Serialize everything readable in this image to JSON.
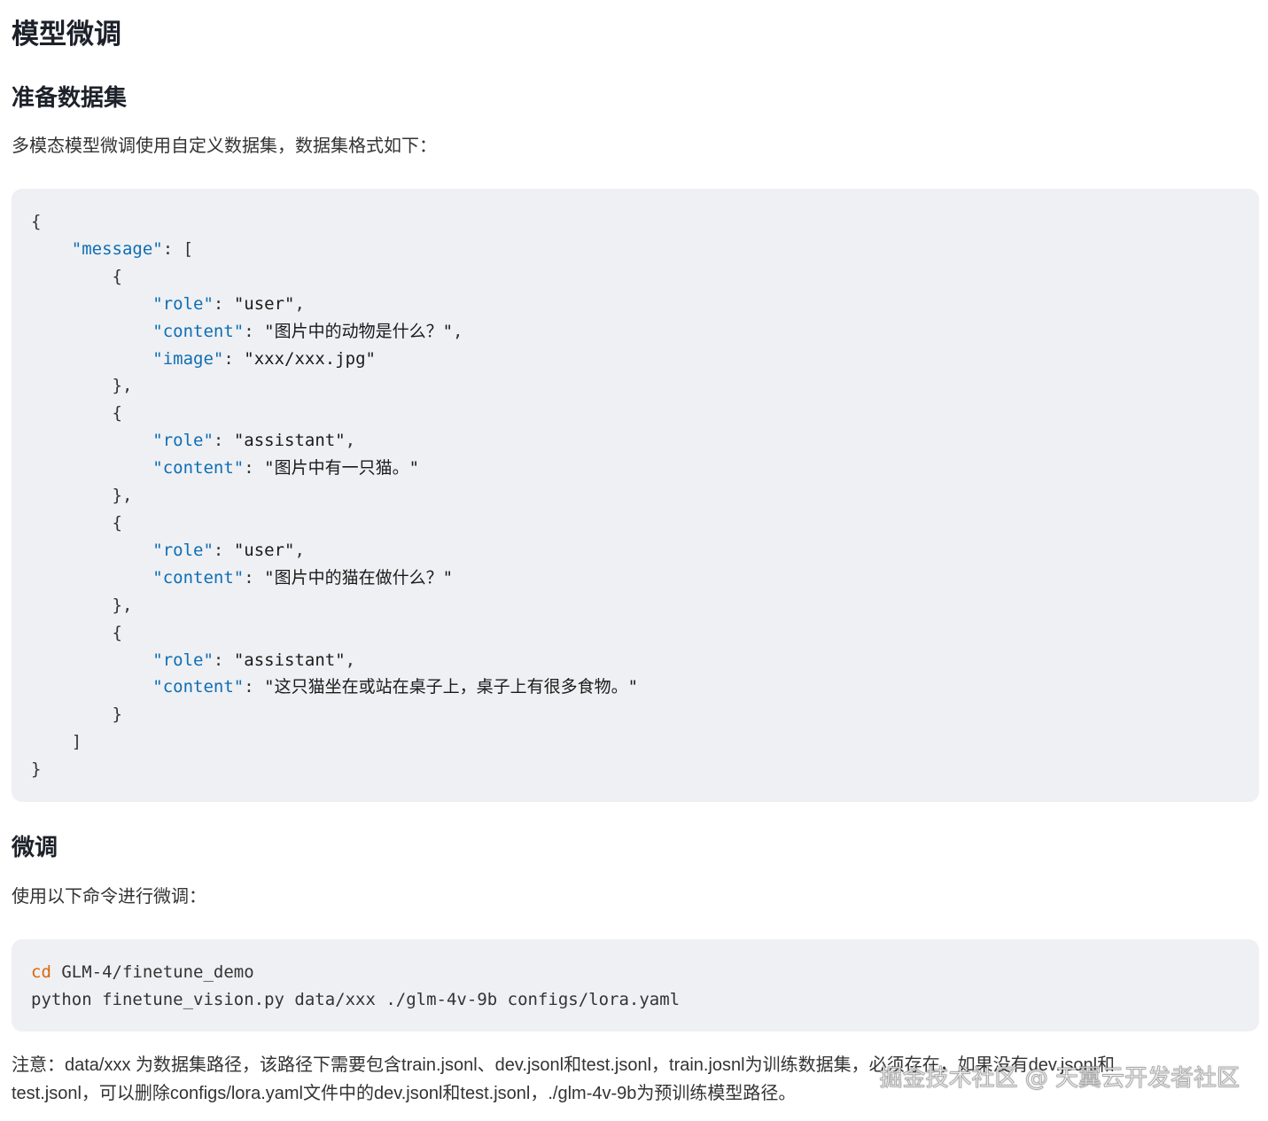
{
  "page": {
    "title": "模型微调"
  },
  "dataset_section": {
    "heading": "准备数据集",
    "intro": "多模态模型微调使用自定义数据集，数据集格式如下：",
    "code_lines": [
      [
        {
          "t": "punc",
          "v": "{"
        }
      ],
      [
        {
          "t": "punc",
          "v": "    "
        },
        {
          "t": "key",
          "v": "\"message\""
        },
        {
          "t": "punc",
          "v": ": ["
        }
      ],
      [
        {
          "t": "punc",
          "v": "        {"
        }
      ],
      [
        {
          "t": "punc",
          "v": "            "
        },
        {
          "t": "key",
          "v": "\"role\""
        },
        {
          "t": "punc",
          "v": ": "
        },
        {
          "t": "str",
          "v": "\"user\""
        },
        {
          "t": "punc",
          "v": ","
        }
      ],
      [
        {
          "t": "punc",
          "v": "            "
        },
        {
          "t": "key",
          "v": "\"content\""
        },
        {
          "t": "punc",
          "v": ": "
        },
        {
          "t": "str",
          "v": "\"图片中的动物是什么？\""
        },
        {
          "t": "punc",
          "v": ","
        }
      ],
      [
        {
          "t": "punc",
          "v": "            "
        },
        {
          "t": "key",
          "v": "\"image\""
        },
        {
          "t": "punc",
          "v": ": "
        },
        {
          "t": "str",
          "v": "\"xxx/xxx.jpg\""
        }
      ],
      [
        {
          "t": "punc",
          "v": "        },"
        }
      ],
      [
        {
          "t": "punc",
          "v": "        {"
        }
      ],
      [
        {
          "t": "punc",
          "v": "            "
        },
        {
          "t": "key",
          "v": "\"role\""
        },
        {
          "t": "punc",
          "v": ": "
        },
        {
          "t": "str",
          "v": "\"assistant\""
        },
        {
          "t": "punc",
          "v": ","
        }
      ],
      [
        {
          "t": "punc",
          "v": "            "
        },
        {
          "t": "key",
          "v": "\"content\""
        },
        {
          "t": "punc",
          "v": ": "
        },
        {
          "t": "str",
          "v": "\"图片中有一只猫。\""
        }
      ],
      [
        {
          "t": "punc",
          "v": "        },"
        }
      ],
      [
        {
          "t": "punc",
          "v": "        {"
        }
      ],
      [
        {
          "t": "punc",
          "v": "            "
        },
        {
          "t": "key",
          "v": "\"role\""
        },
        {
          "t": "punc",
          "v": ": "
        },
        {
          "t": "str",
          "v": "\"user\""
        },
        {
          "t": "punc",
          "v": ","
        }
      ],
      [
        {
          "t": "punc",
          "v": "            "
        },
        {
          "t": "key",
          "v": "\"content\""
        },
        {
          "t": "punc",
          "v": ": "
        },
        {
          "t": "str",
          "v": "\"图片中的猫在做什么？\""
        }
      ],
      [
        {
          "t": "punc",
          "v": "        },"
        }
      ],
      [
        {
          "t": "punc",
          "v": "        {"
        }
      ],
      [
        {
          "t": "punc",
          "v": "            "
        },
        {
          "t": "key",
          "v": "\"role\""
        },
        {
          "t": "punc",
          "v": ": "
        },
        {
          "t": "str",
          "v": "\"assistant\""
        },
        {
          "t": "punc",
          "v": ","
        }
      ],
      [
        {
          "t": "punc",
          "v": "            "
        },
        {
          "t": "key",
          "v": "\"content\""
        },
        {
          "t": "punc",
          "v": ": "
        },
        {
          "t": "str",
          "v": "\"这只猫坐在或站在桌子上，桌子上有很多食物。\""
        }
      ],
      [
        {
          "t": "punc",
          "v": "        }"
        }
      ],
      [
        {
          "t": "punc",
          "v": "    ]"
        }
      ],
      [
        {
          "t": "punc",
          "v": "}"
        }
      ]
    ]
  },
  "finetune_section": {
    "heading": "微调",
    "intro": "使用以下命令进行微调：",
    "code_lines": [
      [
        {
          "t": "cmd",
          "v": "cd"
        },
        {
          "t": "punc",
          "v": " GLM-4/finetune_demo"
        }
      ],
      [
        {
          "t": "punc",
          "v": "python finetune_vision.py data/xxx ./glm-4v-9b configs/lora.yaml"
        }
      ]
    ],
    "note_line1": "注意：data/xxx 为数据集路径，该路径下需要包含train.jsonl、dev.jsonl和test.jsonl，train.josnl为训练数据集，必须存在，如果没有dev.jsonl和",
    "note_line2": "test.jsonl，可以删除configs/lora.yaml文件中的dev.jsonl和test.jsonl，./glm-4v-9b为预训练模型路径。"
  },
  "watermark": "掘金技术社区 @ 天翼云开发者社区",
  "colors": {
    "code_background": "#eff0f3",
    "json_key": "#0d6eb5",
    "shell_command": "#d9670b",
    "body_text": "#333333"
  }
}
